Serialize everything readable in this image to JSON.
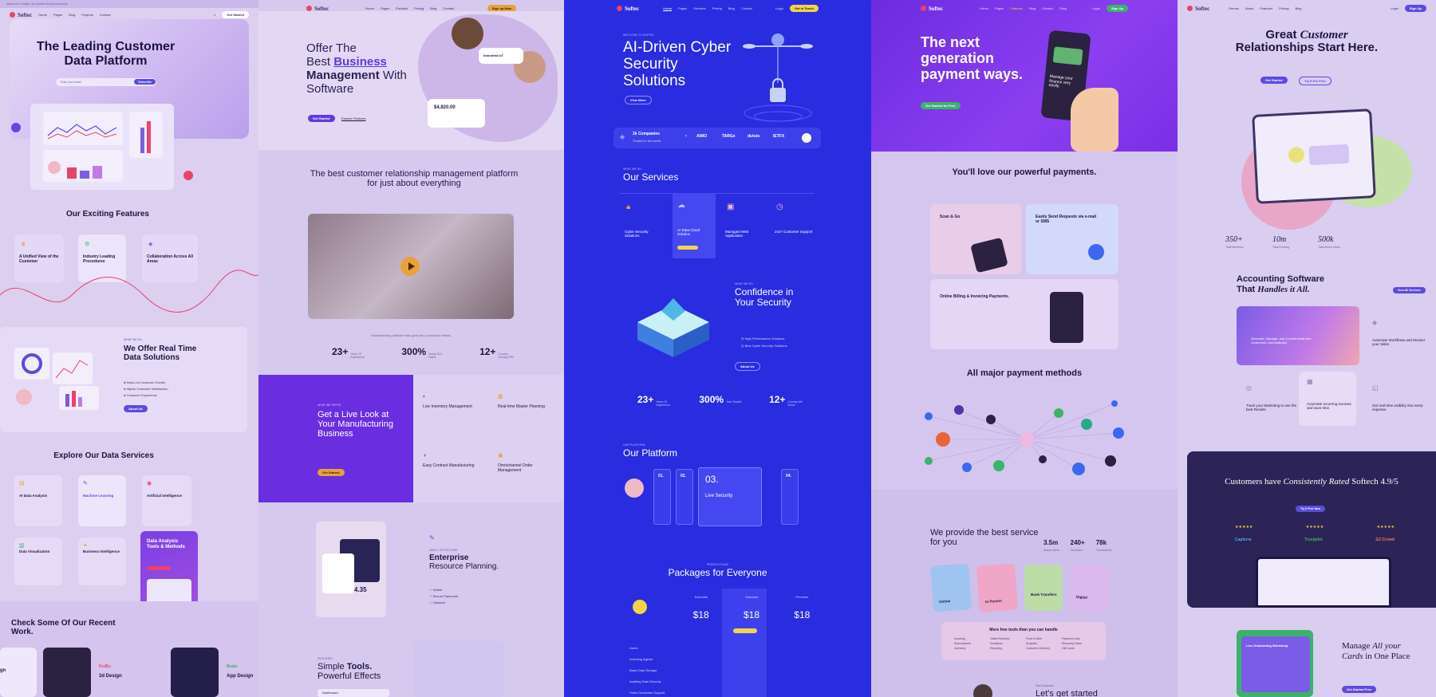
{
  "brand": "Softec",
  "p1": {
    "topbar": "Welcome to Softec, we provide the best solutions",
    "nav": [
      "Home",
      "Pages",
      "Blog",
      "Projects",
      "Contact"
    ],
    "cta": "Get Started",
    "hero_title": "The Leading Customer Data Platform",
    "search_placeholder": "Enter your email",
    "search_btn": "Subscribe",
    "features_title": "Our Exciting Features",
    "features": [
      "A Unified View of the Customer",
      "Industry Leading Procedures",
      "Collaboration Across All Areas"
    ],
    "realtime_kicker": "WHAT WE DO",
    "realtime_title": "We Offer Real Time Data Solutions",
    "realtime_items": [
      "Data-Led Customer Growth",
      "Higher Customer Satisfaction",
      "Customer Experience"
    ],
    "realtime_btn": "About Us",
    "services_title": "Explore Our Data Services",
    "services": [
      "AI Data Analysis",
      "Machine Learning",
      "Artificial Intelligence",
      "Data Visualization",
      "Business Intelligence"
    ],
    "tools_title": "Data Analysis Tools & Methods",
    "work_title": "Check Some Of Our Recent Work.",
    "work": [
      "3d Design",
      "App Design"
    ],
    "work_brands": [
      "FedEx",
      "Beats"
    ]
  },
  "p2": {
    "nav": [
      "Home",
      "Pages",
      "Portfolio",
      "Pricing",
      "Blog",
      "Contact"
    ],
    "cta": "Sign up Now",
    "hero_l1": "Offer The",
    "hero_l2a": "Best ",
    "hero_l2b": "Business",
    "hero_l3a": "Management",
    "hero_l3b": " With",
    "hero_l4": "Software",
    "btn1": "Get Started",
    "btn2": "Explore Features",
    "badge": "Industrial loT",
    "amount": "$4,820.00",
    "crm_title": "The best customer relationship management platform for just about everything",
    "video_caption": "Manufacturing software that gives key production details",
    "stats": [
      {
        "n": "23+",
        "l": "Years Of Experience"
      },
      {
        "n": "300%",
        "l": "Yearly ROI Rates"
      },
      {
        "n": "12+",
        "l": "Country Serving ERP"
      }
    ],
    "live_kicker": "WHAT WE OFFER",
    "live_title": "Get a Live Look at Your Manufacturing Business",
    "live_btn": "Get Started",
    "tiles": [
      "Live Inventory Management",
      "Real-time Master Planning",
      "Easy Contract Manufacturing",
      "Omnichannel Order Management"
    ],
    "erp_kicker": "ABOUT SOFTEC ERP",
    "erp_title1": "Enterprise",
    "erp_title2": "Resource Planning.",
    "erp_items": [
      "Visible",
      "Secure Payments",
      "Optimize"
    ],
    "erp_value": "4.35",
    "tools_kicker": "FEATURES",
    "tools_title1": "Simple ",
    "tools_title2": "Tools.",
    "tools_title3": "Powerful Effects",
    "dash": "Dashboard"
  },
  "p3": {
    "nav": [
      "Home",
      "Pages",
      "Services",
      "Pricing",
      "Blog",
      "Contact"
    ],
    "login": "Login",
    "cta": "Get in Touch",
    "kicker": "WELCOME TO SOFTEC",
    "hero": "AI-Driven Cyber Security Solutions",
    "hero_btn": "View More",
    "trust_num": "2k Companies",
    "trust_txt": "Trusted in the world",
    "logos": [
      "AMIO",
      "TARGx",
      "duluta",
      "IETFX"
    ],
    "svc_kicker": "WHAT WE DO",
    "svc_title": "Our Services",
    "services": [
      "Cyber Security Solutions",
      "AI Data Cloud Solution",
      "Managed Web Application",
      "24x7 Customer Support"
    ],
    "conf_kicker": "WHAT WE DO",
    "conf_title": "Confidence in Your Security",
    "conf_items": [
      "High Performance Solutions",
      "Best Cyber Security Solutions"
    ],
    "conf_btn": "About Us",
    "stats": [
      {
        "n": "23+",
        "l": "Years Of Experience"
      },
      {
        "n": "300%",
        "l": "Year Growth"
      },
      {
        "n": "12+",
        "l": "Country We Serve"
      }
    ],
    "plat_kicker": "OUR PLATFORM",
    "plat_title": "Our Platform",
    "steps": [
      "01.",
      "02.",
      "03.",
      "04."
    ],
    "step_labels": [
      "Threat Intel",
      "Cloud Protection",
      "Live Security",
      "Data Support"
    ],
    "pkg_kicker": "PRICING PLANS",
    "pkg_title": "Packages for Everyone",
    "plans": [
      "Essential",
      "Standard",
      "Premium"
    ],
    "price": "18",
    "rows": [
      "Users",
      "Including Agents",
      "Basic Data Storage",
      "Auditing Data Security",
      "Video Dedicated Support"
    ]
  },
  "p4": {
    "nav": [
      "Home",
      "Pages",
      "Features",
      "Blog",
      "Contact",
      "Shop"
    ],
    "login": "Login",
    "cta": "Sign Up",
    "hero": "The next generation payment ways.",
    "phone_txt": "Manage your finance very easily.",
    "hero_btn": "Get Started for Free",
    "pay_title": "You'll love our powerful payments.",
    "cards": [
      "Scan & Go",
      "Easily Send Requests via e-mail or SMS",
      "Online Billing & Invoicing Payments."
    ],
    "methods_title": "All major payment methods",
    "best_title": "We provide the best service for you",
    "stats": [
      {
        "n": "3.5m",
        "l": "Active Users"
      },
      {
        "n": "240+",
        "l": "Countries"
      },
      {
        "n": "78k",
        "l": "Transactions"
      }
    ],
    "pcards": [
      "Online",
      "In Person",
      "Bank Transfers",
      "Digital"
    ],
    "tools_title": "More free tools than you can handle",
    "tools": [
      "Invoicing",
      "Online Reviews",
      "Point of Sale",
      "Payment Links",
      "Subscriptions",
      "Donations",
      "Analytics",
      "Recurring Sales",
      "Inventory",
      "Reporting",
      "Customer Directory",
      "Gift Cards"
    ],
    "start_kicker": "Start Business",
    "start_title": "Let's get started"
  },
  "p5": {
    "nav": [
      "Demos",
      "About",
      "Features",
      "Pricing",
      "Blog"
    ],
    "login": "Login",
    "cta": "Sign Up",
    "hero_l1a": "Great ",
    "hero_l1b": "Customer",
    "hero_l2": "Relationships Start Here.",
    "btn1": "Get Started",
    "btn2": "Try It For Free",
    "stats": [
      {
        "n": "350+",
        "l": "Total Members"
      },
      {
        "n": "10m",
        "l": "Total Funding"
      },
      {
        "n": "500k",
        "l": "Total Active Users"
      }
    ],
    "acc_title1": "Accounting Software",
    "acc_title2": "That ",
    "acc_title3": "Handles it All.",
    "acc_btn": "View All Services",
    "acc_card": "Generate, Manage, and Convert leads into Customers, Automatically",
    "acc_items": [
      "Automate Workflows and Monitor your Sales",
      "Track your Marketing to see the best Results",
      "Automate recurring invoices and save time.",
      "Get real-time visibility into every expense."
    ],
    "rev_title1": "Customers have ",
    "rev_title2": "Consistently Rated",
    "rev_title3": " Softech 4.9/5",
    "rev_btn": "Try It Free Now",
    "rev_brands": [
      "Capterra",
      "Trustpilot",
      "G2 Crowd"
    ],
    "manage1": "Manage ",
    "manage2": "All your",
    "manage3": "Cards",
    "manage4": " in One Place",
    "manage_btn": "Get Started Free",
    "workshop": "Live Onboarding Workshop"
  }
}
